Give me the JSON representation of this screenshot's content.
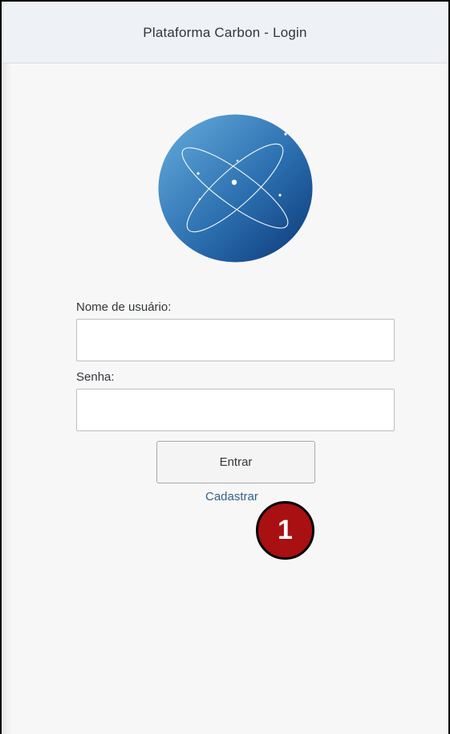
{
  "header": {
    "title": "Plataforma Carbon - Login"
  },
  "logo": {
    "icon": "atom-logo-icon",
    "gradient_start": "#5ea3d6",
    "gradient_end": "#0e3c7c"
  },
  "form": {
    "username_label": "Nome de usuário:",
    "username_value": "",
    "password_label": "Senha:",
    "password_value": "",
    "submit_label": "Entrar",
    "register_link": "Cadastrar"
  },
  "annotation": {
    "step_number": "1",
    "color": "#a81012"
  }
}
